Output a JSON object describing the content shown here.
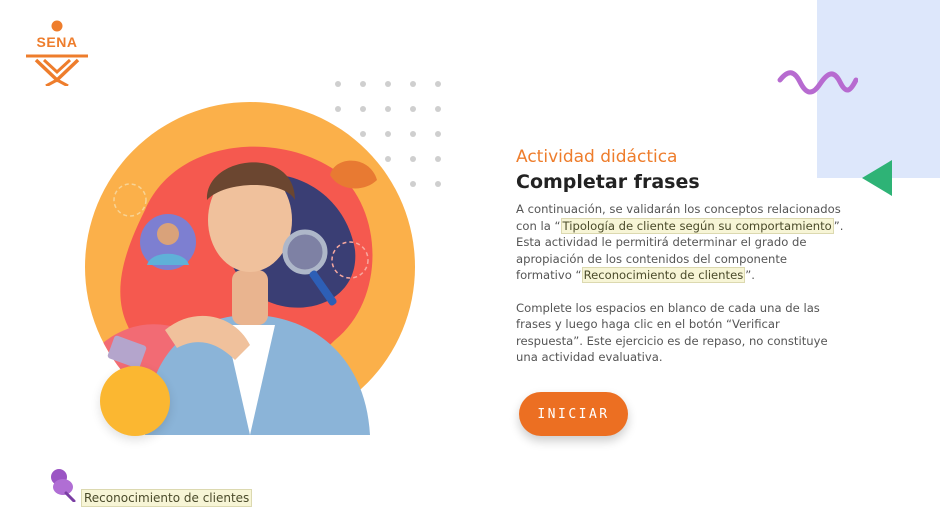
{
  "logo": {
    "text": "SENA"
  },
  "activity": {
    "category": "Actividad didáctica",
    "title": "Completar frases",
    "intro": {
      "before": "A continuación, se validarán los conceptos relacionados con la “",
      "link1": "Tipología de cliente según su comportamiento",
      "middle": "”. Esta actividad le permitirá determinar el grado de apropiación de los contenidos del componente formativo “",
      "link2": "Reconocimiento de clientes",
      "after": "”."
    },
    "instructions": "Complete los espacios en blanco de cada una de las frases y luego haga clic en el botón “Verificar respuesta”. Este ejercicio es de repaso, no constituye una actividad evaluativa.",
    "start_label": "INICIAR"
  },
  "footer": {
    "link_label": "Reconocimiento de clientes"
  },
  "colors": {
    "accent": "#ee7d2c",
    "button": "#ec6f22",
    "panel": "#dde7fb",
    "squiggle": "#b76bd0",
    "triangle": "#2eb376",
    "yellow": "#fbb731",
    "pin": "#9b55c4"
  },
  "icons": {
    "logo": "sena-logo-icon",
    "squiggle": "wave-decoration-icon",
    "triangle": "triangle-decoration-icon",
    "pin": "pushpin-icon"
  }
}
